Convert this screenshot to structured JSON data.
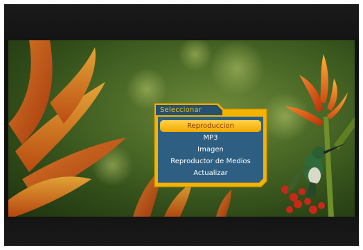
{
  "dialog": {
    "title": "Seleccionar",
    "selected_index": 0,
    "items": [
      {
        "label": "Reproduccion"
      },
      {
        "label": "MP3"
      },
      {
        "label": "Imagen"
      },
      {
        "label": "Reproductor de Medios"
      },
      {
        "label": "Actualizar"
      }
    ]
  },
  "colors": {
    "accent": "#f2b400",
    "panel": "#2e5f82",
    "selection": "#ffc21a",
    "title_text": "#f3c21a"
  }
}
